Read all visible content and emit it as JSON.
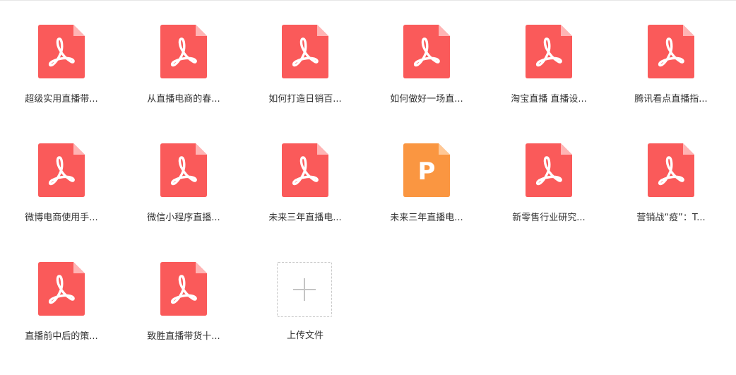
{
  "colors": {
    "pdf": "#fa5a5a",
    "ppt": "#fa9641",
    "fold": "#ffb4b4",
    "fold_ppt": "#ffc896"
  },
  "files": [
    {
      "name": "超级实用直播带...",
      "type": "pdf",
      "icon": "pdf-icon"
    },
    {
      "name": "从直播电商的春...",
      "type": "pdf",
      "icon": "pdf-icon"
    },
    {
      "name": "如何打造日销百...",
      "type": "pdf",
      "icon": "pdf-icon"
    },
    {
      "name": "如何做好一场直...",
      "type": "pdf",
      "icon": "pdf-icon"
    },
    {
      "name": "淘宝直播 直播设...",
      "type": "pdf",
      "icon": "pdf-icon"
    },
    {
      "name": "腾讯看点直播指...",
      "type": "pdf",
      "icon": "pdf-icon"
    },
    {
      "name": "微博电商使用手...",
      "type": "pdf",
      "icon": "pdf-icon"
    },
    {
      "name": "微信小程序直播...",
      "type": "pdf",
      "icon": "pdf-icon"
    },
    {
      "name": "未来三年直播电...",
      "type": "pdf",
      "icon": "pdf-icon"
    },
    {
      "name": "未来三年直播电...",
      "type": "ppt",
      "icon": "ppt-icon",
      "glyph": "P"
    },
    {
      "name": "新零售行业研究...",
      "type": "pdf",
      "icon": "pdf-icon"
    },
    {
      "name": "营销战“疫”：T...",
      "type": "pdf",
      "icon": "pdf-icon"
    },
    {
      "name": "直播前中后的策...",
      "type": "pdf",
      "icon": "pdf-icon"
    },
    {
      "name": "致胜直播带货十...",
      "type": "pdf",
      "icon": "pdf-icon"
    }
  ],
  "upload": {
    "label": "上传文件",
    "icon": "plus-icon"
  }
}
